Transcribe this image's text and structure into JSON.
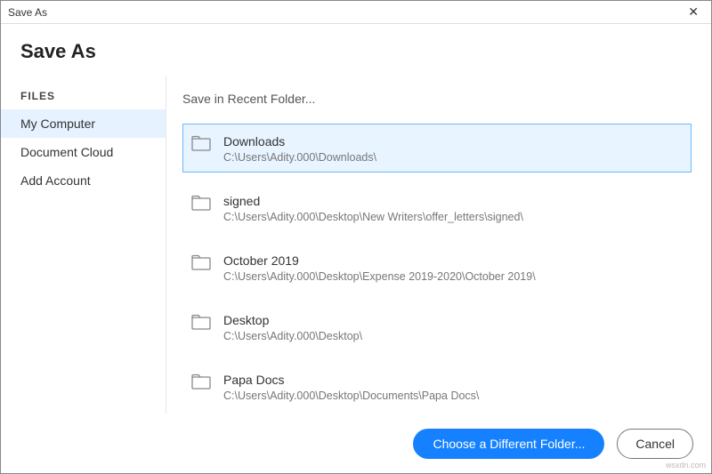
{
  "window": {
    "title": "Save As",
    "close_symbol": "✕"
  },
  "header": {
    "title": "Save As"
  },
  "sidebar": {
    "label": "FILES",
    "items": [
      {
        "label": "My Computer",
        "active": true
      },
      {
        "label": "Document Cloud",
        "active": false
      },
      {
        "label": "Add Account",
        "active": false
      }
    ]
  },
  "main": {
    "section_title": "Save in Recent Folder...",
    "folders": [
      {
        "name": "Downloads",
        "path": "C:\\Users\\Adity.000\\Downloads\\",
        "selected": true
      },
      {
        "name": "signed",
        "path": "C:\\Users\\Adity.000\\Desktop\\New Writers\\offer_letters\\signed\\",
        "selected": false
      },
      {
        "name": "October 2019",
        "path": "C:\\Users\\Adity.000\\Desktop\\Expense 2019-2020\\October 2019\\",
        "selected": false
      },
      {
        "name": "Desktop",
        "path": "C:\\Users\\Adity.000\\Desktop\\",
        "selected": false
      },
      {
        "name": "Papa Docs",
        "path": "C:\\Users\\Adity.000\\Desktop\\Documents\\Papa Docs\\",
        "selected": false
      }
    ]
  },
  "footer": {
    "choose_label": "Choose a Different Folder...",
    "cancel_label": "Cancel"
  },
  "watermark": "wsxdn.com"
}
